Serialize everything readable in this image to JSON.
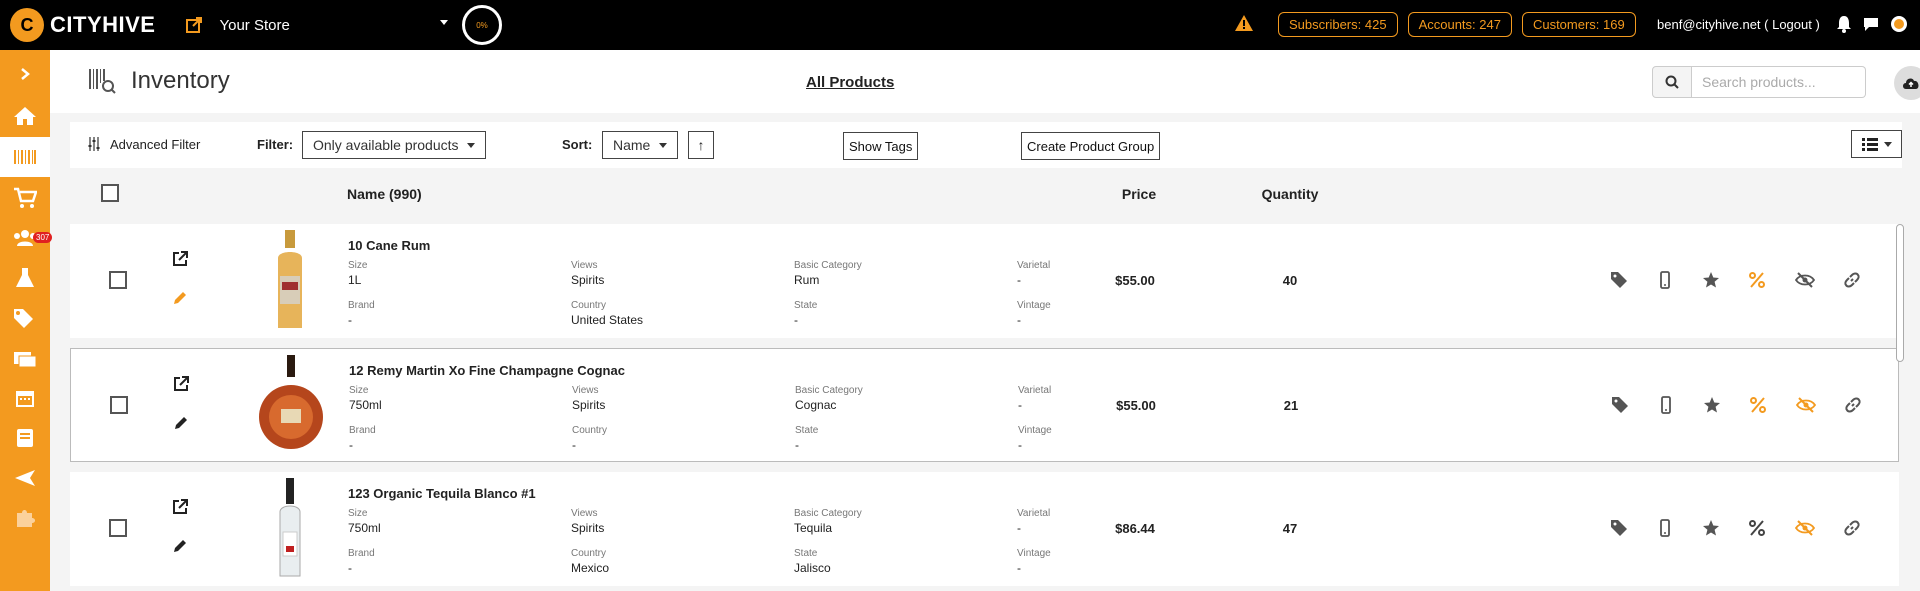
{
  "topbar": {
    "brand": "CITYHIVE",
    "store_name": "Your Store",
    "progress_label": "0%",
    "subscribers": "Subscribers: 425",
    "accounts": "Accounts: 247",
    "customers": "Customers: 169",
    "user": "benf@cityhive.net ( Logout )"
  },
  "sidebar": {
    "cart_badge": "307"
  },
  "header": {
    "title": "Inventory",
    "all_products": "All Products",
    "search_placeholder": "Search products..."
  },
  "filters": {
    "advanced_filter": "Advanced Filter",
    "filter_label": "Filter:",
    "filter_value": "Only available products",
    "sort_label": "Sort:",
    "sort_value": "Name",
    "sort_dir": "↑",
    "show_tags": "Show Tags",
    "create_group": "Create Product Group"
  },
  "table": {
    "col_name": "Name  (990)",
    "col_price": "Price",
    "col_quantity": "Quantity",
    "field_labels": {
      "size": "Size",
      "views": "Views",
      "basic_category": "Basic Category",
      "varietal": "Varietal",
      "brand": "Brand",
      "country": "Country",
      "state": "State",
      "vintage": "Vintage"
    },
    "rows": [
      {
        "name": "10 Cane Rum",
        "size": "1L",
        "views": "Spirits",
        "basic_category": "Rum",
        "varietal": "-",
        "brand": "-",
        "country": "United States",
        "state": "-",
        "vintage": "-",
        "price": "$55.00",
        "quantity": "40"
      },
      {
        "name": "12 Remy Martin Xo Fine Champagne Cognac",
        "size": "750ml",
        "views": "Spirits",
        "basic_category": "Cognac",
        "varietal": "-",
        "brand": "-",
        "country": "-",
        "state": "-",
        "vintage": "-",
        "price": "$55.00",
        "quantity": "21"
      },
      {
        "name": "123 Organic Tequila Blanco #1",
        "size": "750ml",
        "views": "Spirits",
        "basic_category": "Tequila",
        "varietal": "-",
        "brand": "-",
        "country": "Mexico",
        "state": "Jalisco",
        "vintage": "-",
        "price": "$86.44",
        "quantity": "47"
      }
    ]
  },
  "colors": {
    "accent": "#f39a1f",
    "topbar": "#000000"
  }
}
